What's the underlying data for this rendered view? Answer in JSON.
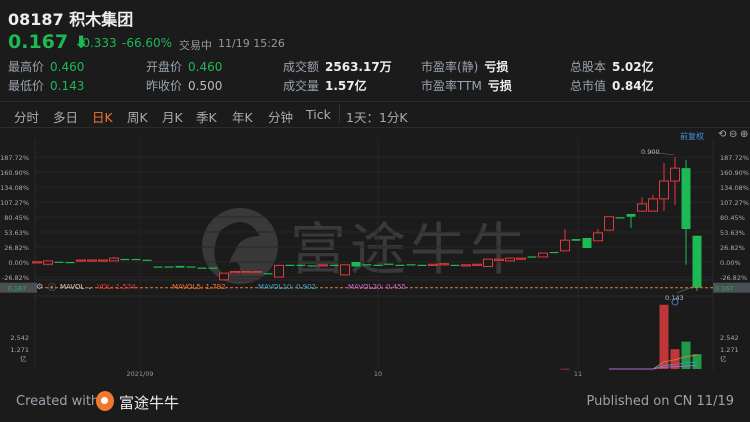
{
  "header": {
    "code": "08187",
    "name": "积木集团",
    "price": "0.167",
    "change": "-0.333",
    "change_pct": "-66.60%",
    "status": "交易中",
    "time": "11/19 15:26"
  },
  "stats": [
    {
      "label": "最高价",
      "value": "0.460"
    },
    {
      "label": "开盘价",
      "value": "0.460"
    },
    {
      "label": "成交额",
      "value": "2563.17万"
    },
    {
      "label": "市盈率(静)",
      "value": "亏损"
    },
    {
      "label": "总股本",
      "value": "5.02亿"
    },
    {
      "label": "最低价",
      "value": "0.143"
    },
    {
      "label": "昨收价",
      "value": "0.500"
    },
    {
      "label": "成交量",
      "value": "1.57亿"
    },
    {
      "label": "市盈率TTM",
      "value": "亏损"
    },
    {
      "label": "总市值",
      "value": "0.84亿"
    }
  ],
  "tabs": [
    "分时",
    "多日",
    "日K",
    "周K",
    "月K",
    "季K",
    "年K",
    "分钟",
    "Tick",
    "1天：1分K"
  ],
  "active_tab": "日K",
  "toolbar": {
    "adjust": "前复权"
  },
  "colors": {
    "up": "#e0393e",
    "down": "#1db954",
    "accent": "#f0782d"
  },
  "chart_data": {
    "type": "candlestick",
    "y_unit": "percent",
    "yticks": [
      "187.72%",
      "160.90%",
      "134.08%",
      "107.27%",
      "80.45%",
      "53.63%",
      "26.82%",
      "0.00%",
      "-26.82%"
    ],
    "ytick_values": [
      187.72,
      160.9,
      134.08,
      107.27,
      80.45,
      53.63,
      26.82,
      0,
      -26.82
    ],
    "xticks": [
      "2021/09",
      "10",
      "11"
    ],
    "last_price_label": "0.167",
    "high_label": "0.900",
    "low_label": "0.143",
    "candles_ochl_note": "[open, close, high, low] in percent",
    "candles": [
      [
        0,
        0.5,
        1,
        -1
      ],
      [
        -4,
        2,
        2,
        -6
      ],
      [
        0.5,
        0,
        0.5,
        0
      ],
      [
        0,
        -0.5,
        0,
        -0.5
      ],
      [
        3,
        3.6,
        4,
        3
      ],
      [
        3,
        3.6,
        4,
        3
      ],
      [
        3,
        3.6,
        4,
        3
      ],
      [
        2,
        7,
        9,
        2
      ],
      [
        5.5,
        5,
        5.5,
        5
      ],
      [
        5.5,
        5,
        5.5,
        5
      ],
      [
        4,
        3,
        4,
        3
      ],
      [
        -8,
        -9,
        -8,
        -9
      ],
      [
        -8,
        -9,
        -8,
        -9
      ],
      [
        -7,
        -10,
        -7,
        -10
      ],
      [
        -8,
        -9,
        -8,
        -9
      ],
      [
        -10,
        -11,
        -10,
        -11
      ],
      [
        -10,
        -11,
        -10,
        -11
      ],
      [
        -32,
        -20,
        -20,
        -32
      ],
      [
        -18,
        -17,
        -17,
        -18
      ],
      [
        -18,
        -17,
        -17,
        -18
      ],
      [
        -18,
        -17,
        -17,
        -18
      ],
      [
        -20,
        -21,
        -20,
        -21
      ],
      [
        -27,
        -6,
        -5,
        -27
      ],
      [
        -5,
        -6,
        -5,
        -6
      ],
      [
        -5,
        -6,
        -5,
        -6
      ],
      [
        -6,
        -7,
        -6,
        -7
      ],
      [
        -6,
        -5,
        -5,
        -6
      ],
      [
        -5,
        -6,
        -5,
        -6
      ],
      [
        -23,
        -5,
        -5,
        -23
      ],
      [
        0,
        -8,
        0,
        -8
      ],
      [
        -4,
        -5,
        -4,
        -5
      ],
      [
        -5,
        -6,
        -5,
        -6
      ],
      [
        -3,
        -5,
        -3,
        -5
      ],
      [
        -5,
        -6,
        -5,
        -6
      ],
      [
        -4,
        -5,
        -4,
        -5
      ],
      [
        -5,
        -6,
        -5,
        -6
      ],
      [
        -5,
        -4,
        -4,
        -5
      ],
      [
        -4,
        -3,
        -3,
        -4
      ],
      [
        -5,
        -6,
        -5,
        -6
      ],
      [
        -6,
        -5,
        -5,
        -6
      ],
      [
        -5,
        -4,
        -4,
        -5
      ],
      [
        -8,
        5,
        6,
        -8
      ],
      [
        3,
        5,
        5,
        3
      ],
      [
        2,
        7,
        8,
        2
      ],
      [
        6,
        7,
        7,
        6
      ],
      [
        10,
        8,
        10,
        8
      ],
      [
        9,
        16,
        16,
        9
      ],
      [
        18,
        16,
        18,
        16
      ],
      [
        20,
        39,
        59,
        20
      ],
      [
        41,
        38,
        41,
        38
      ],
      [
        43,
        25,
        43,
        25
      ],
      [
        38,
        52,
        59,
        38
      ],
      [
        57,
        81,
        81,
        57
      ],
      [
        80,
        79,
        80,
        79
      ],
      [
        86,
        81,
        86,
        61
      ],
      [
        91,
        104,
        116,
        91
      ],
      [
        91,
        113,
        120,
        91
      ],
      [
        113,
        145,
        177,
        91
      ],
      [
        145,
        168,
        188,
        102
      ],
      [
        168,
        59,
        183,
        -5
      ],
      [
        47,
        -46,
        47,
        -52
      ]
    ],
    "volume": {
      "legend": {
        "name": "MAVOL",
        "vol": "VOL: 1.574",
        "ma5": "MAVOL5: 1.792",
        "ma10": "MAVOL10: 0.902",
        "ma20": "MAVOL20: 0.455"
      },
      "yticks": [
        "2.542",
        "1.271"
      ],
      "ytick_values": [
        2.542,
        1.271
      ],
      "unit": "亿",
      "values": {
        "48": 0.03,
        "55": 0.05,
        "57": 6.8,
        "58": 2.1,
        "59": 2.9,
        "60": 1.574
      }
    }
  },
  "footer": {
    "created": "Created with",
    "brand": "富途牛牛",
    "published": "Published on CN 11/19"
  },
  "watermark": "富途牛牛"
}
